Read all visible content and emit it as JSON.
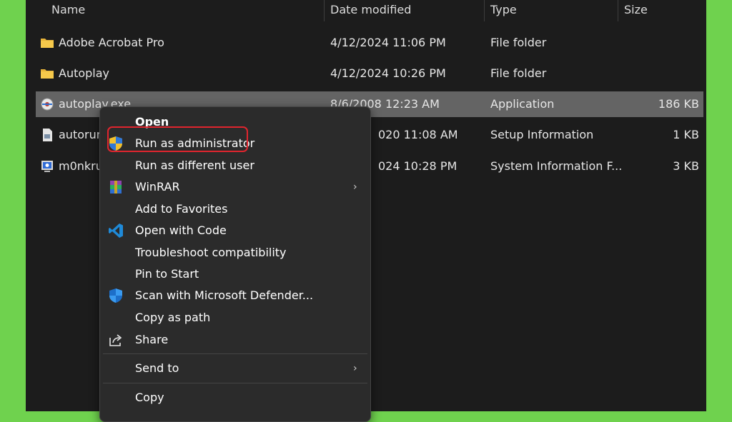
{
  "columns": {
    "name": "Name",
    "date": "Date modified",
    "type": "Type",
    "size": "Size"
  },
  "files": [
    {
      "name": "Adobe Acrobat Pro",
      "date": "4/12/2024 11:06 PM",
      "type": "File folder",
      "size": "",
      "icon": "folder-icon"
    },
    {
      "name": "Autoplay",
      "date": "4/12/2024 10:26 PM",
      "type": "File folder",
      "size": "",
      "icon": "folder-icon"
    },
    {
      "name": "autoplay.exe",
      "date": "8/6/2008 12:23 AM",
      "type": "Application",
      "size": "186 KB",
      "icon": "app-icon",
      "selected": true
    },
    {
      "name": "autorun",
      "date": "020 11:08 AM",
      "type": "Setup Information",
      "size": "1 KB",
      "icon": "setup-info-icon"
    },
    {
      "name": "m0nkru",
      "date": "024 10:28 PM",
      "type": "System Information F...",
      "size": "3 KB",
      "icon": "system-info-icon"
    }
  ],
  "context_menu": {
    "items": [
      {
        "label": "Open",
        "bold": true
      },
      {
        "label": "Run as administrator",
        "icon": "uac-shield-icon",
        "highlighted": true
      },
      {
        "label": "Run as different user"
      },
      {
        "label": "WinRAR",
        "icon": "winrar-icon",
        "submenu": true
      },
      {
        "label": "Add to Favorites"
      },
      {
        "label": "Open with Code",
        "icon": "vscode-icon"
      },
      {
        "label": "Troubleshoot compatibility"
      },
      {
        "label": "Pin to Start"
      },
      {
        "label": "Scan with Microsoft Defender...",
        "icon": "defender-shield-icon"
      },
      {
        "label": "Copy as path"
      },
      {
        "label": "Share",
        "icon": "share-icon"
      },
      {
        "label": "Send to",
        "submenu": true
      },
      {
        "label": "Copy"
      }
    ],
    "submenu_glyph": "›"
  },
  "colors": {
    "background": "#6fd24e",
    "highlight_border": "#e0252e",
    "selection": "#646464"
  }
}
